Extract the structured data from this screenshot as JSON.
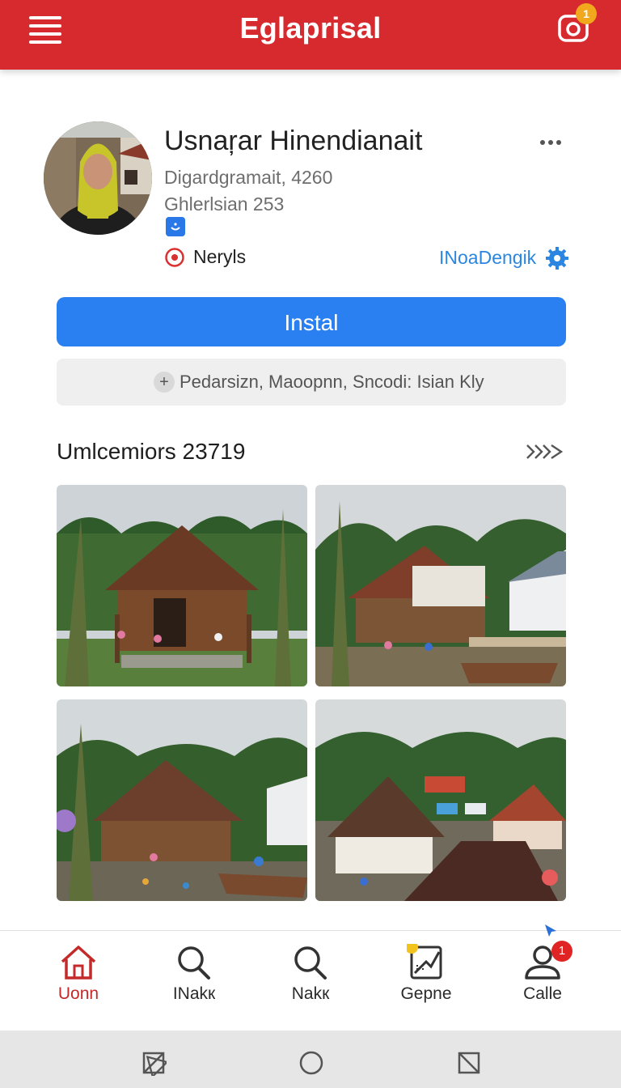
{
  "app": {
    "title": "Eglaprisal",
    "camera_badge": "1",
    "accent": "#d72a2f"
  },
  "profile": {
    "name": "Usnaŗar Hinendianait",
    "meta_line_1": "Digardgramait, 4260",
    "meta_line_2": "Ghlerlsian 253",
    "status_label": "Neryls",
    "link_label": "INoaDengik"
  },
  "actions": {
    "install_label": "Instal",
    "info_text": "Pedarsizn, Maoopnn, Sncodi: Isian Kly"
  },
  "gallery": {
    "title": "Umlcemiors 23719",
    "more_label": "›››",
    "photos": [
      {
        "name": "wooden house with palm trees"
      },
      {
        "name": "village house near boat"
      },
      {
        "name": "house with children and boat"
      },
      {
        "name": "village aerial view"
      }
    ]
  },
  "bottom_nav": {
    "items": [
      {
        "label": "Uonn",
        "icon": "home-icon"
      },
      {
        "label": "INakк",
        "icon": "search-icon"
      },
      {
        "label": "Nakк",
        "icon": "search-icon"
      },
      {
        "label": "Gepne",
        "icon": "chart-icon"
      },
      {
        "label": "Calle",
        "icon": "profile-icon"
      }
    ],
    "profile_badge": "1"
  },
  "system_nav": [
    "back-icon",
    "home-circle-icon",
    "recents-icon"
  ]
}
